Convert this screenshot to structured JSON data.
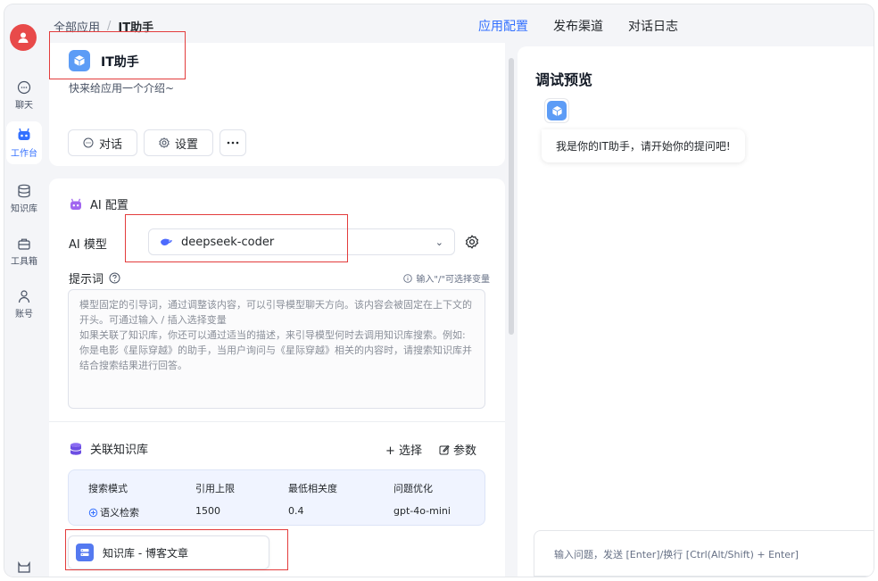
{
  "breadcrumb": {
    "root": "全部应用",
    "sep": "/",
    "current": "IT助手"
  },
  "tabs": [
    {
      "label": "应用配置",
      "active": true
    },
    {
      "label": "发布渠道",
      "active": false
    },
    {
      "label": "对话日志",
      "active": false
    }
  ],
  "sidebar": {
    "items": [
      {
        "label": "聊天",
        "icon": "chat-bubble-icon"
      },
      {
        "label": "工作台",
        "icon": "robot-icon",
        "active": true
      },
      {
        "label": "知识库",
        "icon": "database-icon"
      },
      {
        "label": "工具箱",
        "icon": "toolbox-icon"
      },
      {
        "label": "账号",
        "icon": "user-icon"
      }
    ],
    "bottom_icon": "github-icon"
  },
  "app": {
    "name": "IT助手",
    "intro": "快来给应用一个介绍~",
    "chat_btn": "对话",
    "settings_btn": "设置"
  },
  "ai_config": {
    "title": "AI 配置",
    "model_label": "AI 模型",
    "model_value": "deepseek-coder",
    "prompt_label": "提示词",
    "prompt_hint": "输入\"/\"可选择变量",
    "prompt_placeholder": "模型固定的引导词，通过调整该内容，可以引导模型聊天方向。该内容会被固定在上下文的开头。可通过输入 / 插入选择变量\n如果关联了知识库，你还可以通过适当的描述，来引导模型何时去调用知识库搜索。例如:\n你是电影《星际穿越》的助手，当用户询问与《星际穿越》相关的内容时，请搜索知识库并结合搜索结果进行回答。"
  },
  "knowledge": {
    "title": "关联知识库",
    "select_label": "+ 选择",
    "params_label": "参数",
    "headers": [
      "搜索模式",
      "引用上限",
      "最低相关度",
      "问题优化"
    ],
    "values": [
      "语义检索",
      "1500",
      "0.4",
      "gpt-4o-mini"
    ],
    "item": "知识库 - 博客文章"
  },
  "preview": {
    "title": "调试预览",
    "welcome": "我是你的IT助手，请开始你的提问吧!",
    "input_placeholder": "输入问题，发送 [Enter]/换行 [Ctrl(Alt/Shift) + Enter]"
  },
  "colors": {
    "accent": "#3370ff",
    "highlight_box": "#e33c3c",
    "app_icon": "#5c9cf6"
  }
}
